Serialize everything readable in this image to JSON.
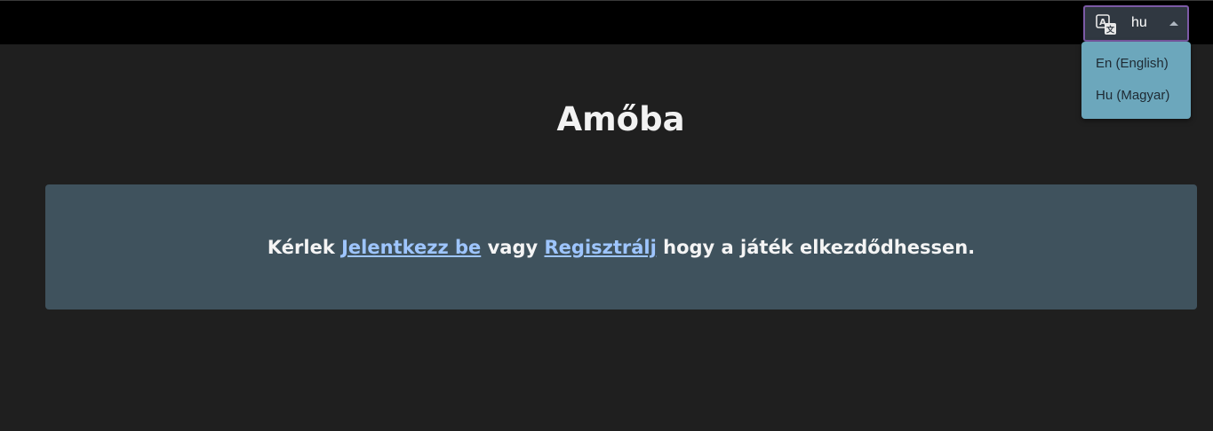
{
  "header": {
    "language_selector": {
      "icon": "translate-icon",
      "value": "hu",
      "options": [
        {
          "label": "En (English)"
        },
        {
          "label": "Hu (Magyar)"
        }
      ]
    }
  },
  "main": {
    "title": "Amőba",
    "notice": {
      "prefix": "Kérlek",
      "login_link": "Jelentkezz be",
      "middle": "vagy",
      "register_link": "Regisztrálj",
      "suffix": "hogy a játék elkezdődhessen."
    }
  },
  "colors": {
    "background": "#1f1f1f",
    "topbar": "#000000",
    "notice_background": "#3f525d",
    "link": "#9ec5fe",
    "menu_background": "#6ca7bc",
    "selector_border": "#7c5aa6"
  }
}
